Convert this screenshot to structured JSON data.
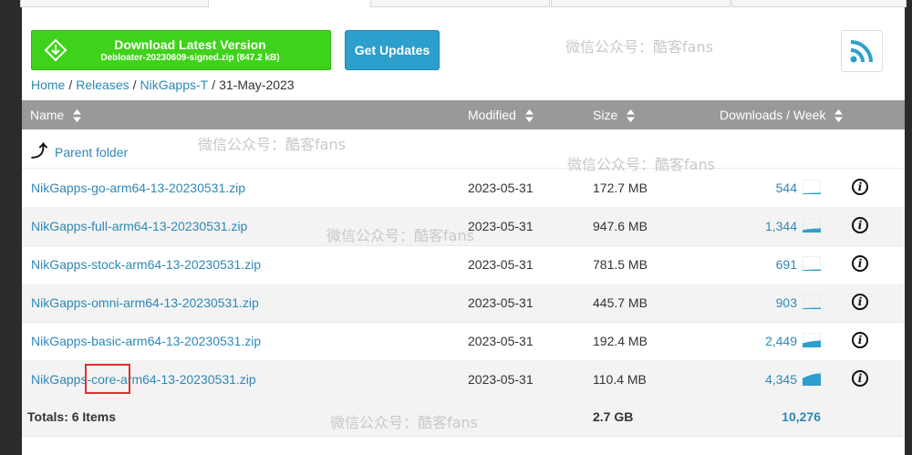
{
  "download": {
    "title": "Download Latest Version",
    "subtitle": "Debloater-20230609-signed.zip (847.2 kB)"
  },
  "get_updates": "Get Updates",
  "watermark_text": "微信公众号：酷客fans",
  "breadcrumb": {
    "home": "Home",
    "releases": "Releases",
    "folder": "NikGapps-T",
    "current": "31-May-2023",
    "separator": "/"
  },
  "table": {
    "headers": {
      "name": "Name",
      "modified": "Modified",
      "size": "Size",
      "downloads": "Downloads / Week"
    },
    "parent_folder": "Parent folder",
    "rows": [
      {
        "name": "NikGapps-go-arm64-13-20230531.zip",
        "modified": "2023-05-31",
        "size": "172.7 MB",
        "downloads": "544",
        "spark_level": 0.1
      },
      {
        "name": "NikGapps-full-arm64-13-20230531.zip",
        "modified": "2023-05-31",
        "size": "947.6 MB",
        "downloads": "1,344",
        "spark_level": 0.3
      },
      {
        "name": "NikGapps-stock-arm64-13-20230531.zip",
        "modified": "2023-05-31",
        "size": "781.5 MB",
        "downloads": "691",
        "spark_level": 0.1
      },
      {
        "name": "NikGapps-omni-arm64-13-20230531.zip",
        "modified": "2023-05-31",
        "size": "445.7 MB",
        "downloads": "903",
        "spark_level": 0.1
      },
      {
        "name": "NikGapps-basic-arm64-13-20230531.zip",
        "modified": "2023-05-31",
        "size": "192.4 MB",
        "downloads": "2,449",
        "spark_level": 0.5
      },
      {
        "name": "NikGapps-core-arm64-13-20230531.zip",
        "modified": "2023-05-31",
        "size": "110.4 MB",
        "downloads": "4,345",
        "spark_level": 0.9
      }
    ],
    "totals": {
      "label": "Totals: 6 Items",
      "size": "2.7 GB",
      "downloads": "10,276"
    }
  },
  "colors": {
    "download_green": "#3fd21a",
    "accent_blue": "#2d9fcd",
    "link_blue": "#2d88b7",
    "header_gray": "#999999",
    "highlight_red": "#e03030"
  }
}
